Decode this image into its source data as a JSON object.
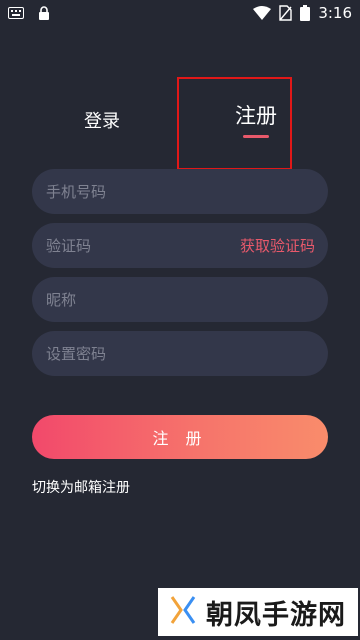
{
  "status_bar": {
    "time": "3:16",
    "icons": [
      "keyboard-icon",
      "lock-icon",
      "wifi-icon",
      "no-sim-icon",
      "battery-icon"
    ]
  },
  "tabs": {
    "login": "登录",
    "register": "注册",
    "active": "register"
  },
  "form": {
    "phone_placeholder": "手机号码",
    "code_placeholder": "验证码",
    "get_code_label": "获取验证码",
    "nickname_placeholder": "昵称",
    "password_placeholder": "设置密码",
    "submit_label": "注 册",
    "switch_label": "切换为邮箱注册"
  },
  "watermark": {
    "text": "朝凤手游网"
  },
  "colors": {
    "background": "#252833",
    "field_bg": "#33374a",
    "accent": "#e8596b",
    "button_gradient_start": "#f2496b",
    "button_gradient_end": "#f98c6b",
    "highlight_box": "#e11818"
  }
}
